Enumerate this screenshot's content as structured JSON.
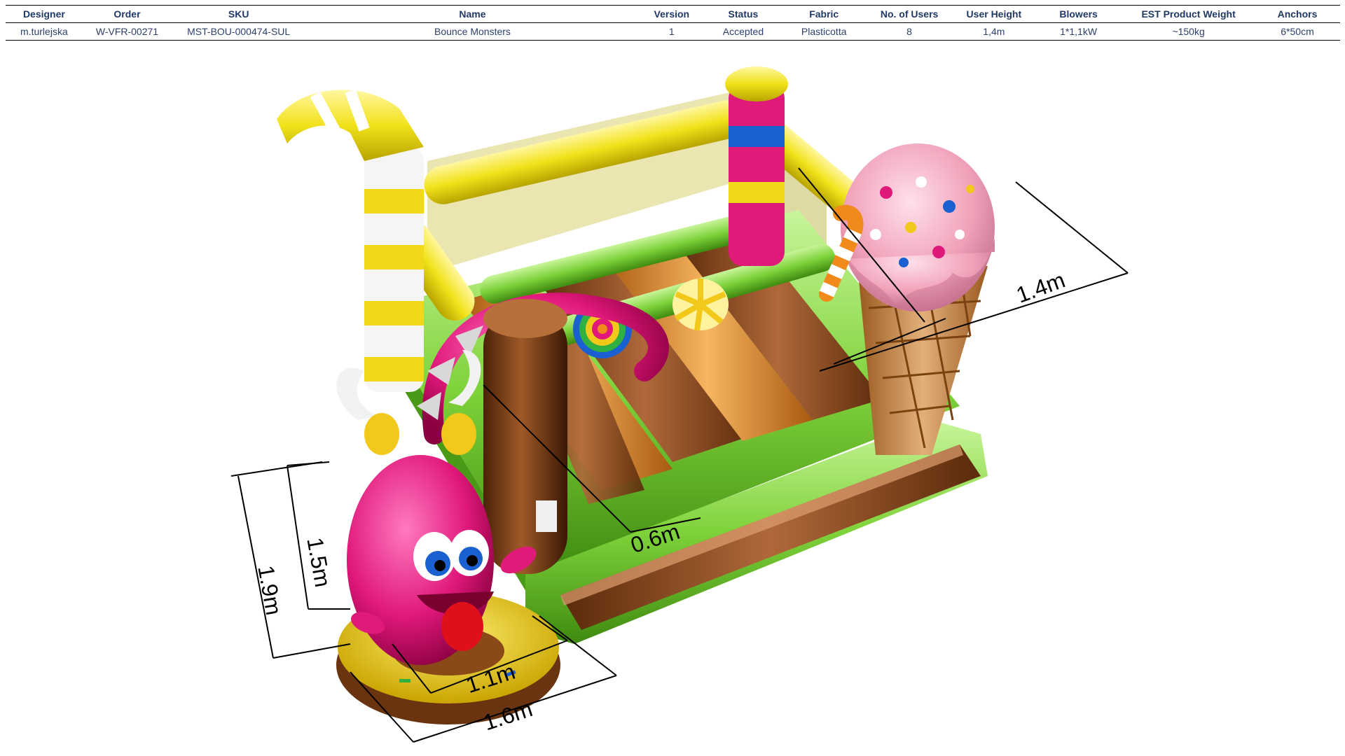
{
  "spec_table": {
    "headers": {
      "designer": "Designer",
      "order": "Order",
      "sku": "SKU",
      "name": "Name",
      "version": "Version",
      "status": "Status",
      "fabric": "Fabric",
      "users": "No. of Users",
      "height": "User  Height",
      "blowers": "Blowers",
      "weight": "EST Product Weight",
      "anchors": "Anchors"
    },
    "row": {
      "designer": "m.turlejska",
      "order": "W-VFR-00271",
      "sku": "MST-BOU-000474-SUL",
      "name": "Bounce Monsters",
      "version": "1",
      "status": "Accepted",
      "fabric": "Plasticotta",
      "users": "8",
      "height": "1,4m",
      "blowers": "1*1,1kW",
      "weight": "~150kg",
      "anchors": "6*50cm"
    }
  },
  "dimensions": {
    "width_top": "1.4m",
    "gap": "0.6m",
    "monster_height": "1.5m",
    "total_height": "1.9m",
    "base_inner": "1.1m",
    "base_outer": "1.6m"
  },
  "colors": {
    "yellow": "#f2e21a",
    "green": "#7ed23a",
    "brown": "#8b4a1e",
    "orange": "#e08a2a",
    "pink": "#e0187a",
    "icecream": "#f0a0b8",
    "cone": "#c98a4a"
  }
}
